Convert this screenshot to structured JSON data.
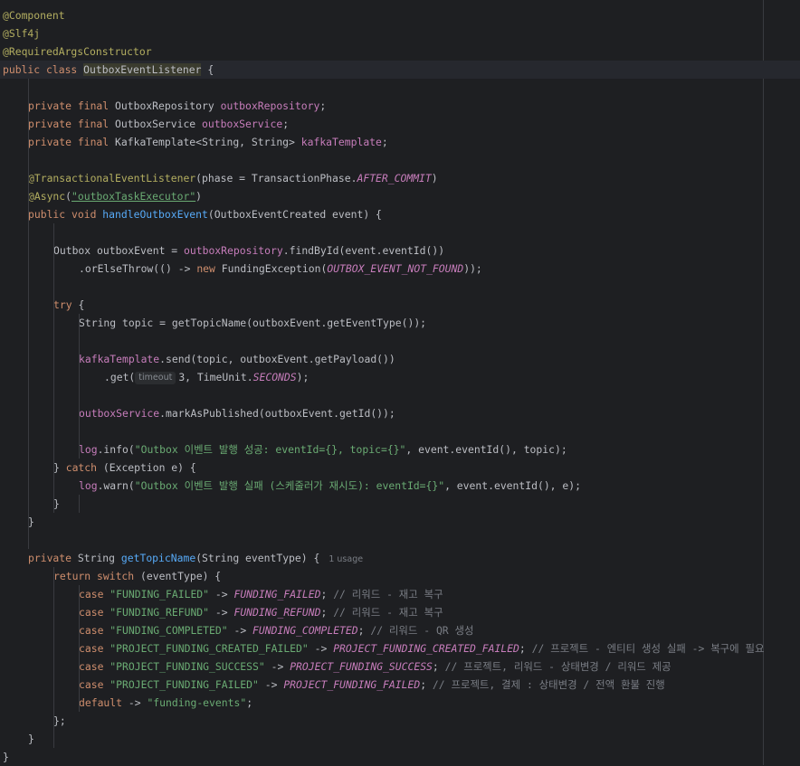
{
  "editor": {
    "file_class": "OutboxEventListener",
    "usage_hint": "1 usage",
    "param_hint": "timeout",
    "lines": [
      {
        "indent": 0,
        "tokens": [
          {
            "t": "@Component",
            "c": "a"
          }
        ]
      },
      {
        "indent": 0,
        "tokens": [
          {
            "t": "@Slf4j",
            "c": "a"
          }
        ]
      },
      {
        "indent": 0,
        "tokens": [
          {
            "t": "@RequiredArgsConstructor",
            "c": "a"
          }
        ]
      },
      {
        "indent": 0,
        "current": true,
        "tokens": [
          {
            "t": "public class ",
            "c": "k"
          },
          {
            "t": "OutboxEventListener",
            "c": "p hl"
          },
          {
            "t": " {",
            "c": "p"
          }
        ]
      },
      {
        "indent": 0,
        "tokens": []
      },
      {
        "indent": 1,
        "tokens": [
          {
            "t": "private final ",
            "c": "k"
          },
          {
            "t": "OutboxRepository ",
            "c": "p"
          },
          {
            "t": "outboxRepository",
            "c": "fld"
          },
          {
            "t": ";",
            "c": "p"
          }
        ]
      },
      {
        "indent": 1,
        "tokens": [
          {
            "t": "private final ",
            "c": "k"
          },
          {
            "t": "OutboxService ",
            "c": "p"
          },
          {
            "t": "outboxService",
            "c": "fld"
          },
          {
            "t": ";",
            "c": "p"
          }
        ]
      },
      {
        "indent": 1,
        "tokens": [
          {
            "t": "private final ",
            "c": "k"
          },
          {
            "t": "KafkaTemplate<String, String> ",
            "c": "p"
          },
          {
            "t": "kafkaTemplate",
            "c": "fld"
          },
          {
            "t": ";",
            "c": "p"
          }
        ]
      },
      {
        "indent": 0,
        "tokens": []
      },
      {
        "indent": 1,
        "tokens": [
          {
            "t": "@TransactionalEventListener",
            "c": "a"
          },
          {
            "t": "(phase = TransactionPhase.",
            "c": "p"
          },
          {
            "t": "AFTER_COMMIT",
            "c": "st"
          },
          {
            "t": ")",
            "c": "p"
          }
        ]
      },
      {
        "indent": 1,
        "tokens": [
          {
            "t": "@Async",
            "c": "a"
          },
          {
            "t": "(",
            "c": "p"
          },
          {
            "t": "\"outboxTaskExecutor\"",
            "c": "s ul"
          },
          {
            "t": ")",
            "c": "p"
          }
        ]
      },
      {
        "indent": 1,
        "tokens": [
          {
            "t": "public void ",
            "c": "k"
          },
          {
            "t": "handleOutboxEvent",
            "c": "f"
          },
          {
            "t": "(OutboxEventCreated event) {",
            "c": "p"
          }
        ]
      },
      {
        "indent": 0,
        "tokens": []
      },
      {
        "indent": 2,
        "tokens": [
          {
            "t": "Outbox outboxEvent = ",
            "c": "p"
          },
          {
            "t": "outboxRepository",
            "c": "fld"
          },
          {
            "t": ".findById(event.eventId())",
            "c": "p"
          }
        ]
      },
      {
        "indent": 3,
        "tokens": [
          {
            "t": ".orElseThrow(() -> ",
            "c": "p"
          },
          {
            "t": "new ",
            "c": "k"
          },
          {
            "t": "FundingException(",
            "c": "p"
          },
          {
            "t": "OUTBOX_EVENT_NOT_FOUND",
            "c": "st"
          },
          {
            "t": "));",
            "c": "p"
          }
        ]
      },
      {
        "indent": 0,
        "tokens": []
      },
      {
        "indent": 2,
        "tokens": [
          {
            "t": "try ",
            "c": "k"
          },
          {
            "t": "{",
            "c": "p"
          }
        ]
      },
      {
        "indent": 3,
        "tokens": [
          {
            "t": "String topic = getTopicName(outboxEvent.getEventType());",
            "c": "p"
          }
        ]
      },
      {
        "indent": 0,
        "tokens": []
      },
      {
        "indent": 3,
        "tokens": [
          {
            "t": "kafkaTemplate",
            "c": "fld"
          },
          {
            "t": ".send(topic, outboxEvent.getPayload())",
            "c": "p"
          }
        ]
      },
      {
        "indent": 4,
        "hint": true,
        "tokens": [
          {
            "t": ".get(",
            "c": "p"
          },
          {
            "t": "HINT",
            "c": "hint"
          },
          {
            "t": "3, TimeUnit.",
            "c": "p"
          },
          {
            "t": "SECONDS",
            "c": "st"
          },
          {
            "t": ");",
            "c": "p"
          }
        ]
      },
      {
        "indent": 0,
        "tokens": []
      },
      {
        "indent": 3,
        "tokens": [
          {
            "t": "outboxService",
            "c": "fld"
          },
          {
            "t": ".markAsPublished(outboxEvent.getId());",
            "c": "p"
          }
        ]
      },
      {
        "indent": 0,
        "tokens": []
      },
      {
        "indent": 3,
        "tokens": [
          {
            "t": "log",
            "c": "fld"
          },
          {
            "t": ".info(",
            "c": "p"
          },
          {
            "t": "\"Outbox 이벤트 발행 성공: eventId={}, topic={}\"",
            "c": "s"
          },
          {
            "t": ", event.eventId(), topic);",
            "c": "p"
          }
        ]
      },
      {
        "indent": 2,
        "tokens": [
          {
            "t": "} ",
            "c": "p"
          },
          {
            "t": "catch ",
            "c": "k"
          },
          {
            "t": "(Exception e) {",
            "c": "p"
          }
        ]
      },
      {
        "indent": 3,
        "tokens": [
          {
            "t": "log",
            "c": "fld"
          },
          {
            "t": ".warn(",
            "c": "p"
          },
          {
            "t": "\"Outbox 이벤트 발행 실패 (스케줄러가 재시도): eventId={}\"",
            "c": "s"
          },
          {
            "t": ", event.eventId(), e);",
            "c": "p"
          }
        ]
      },
      {
        "indent": 2,
        "tokens": [
          {
            "t": "}",
            "c": "p"
          }
        ]
      },
      {
        "indent": 1,
        "tokens": [
          {
            "t": "}",
            "c": "p"
          }
        ]
      },
      {
        "indent": 0,
        "tokens": []
      },
      {
        "indent": 1,
        "usage": true,
        "tokens": [
          {
            "t": "private ",
            "c": "k"
          },
          {
            "t": "String ",
            "c": "p"
          },
          {
            "t": "getTopicName",
            "c": "f"
          },
          {
            "t": "(String eventType) {",
            "c": "p"
          }
        ]
      },
      {
        "indent": 2,
        "tokens": [
          {
            "t": "return switch ",
            "c": "k"
          },
          {
            "t": "(eventType) {",
            "c": "p"
          }
        ]
      },
      {
        "indent": 3,
        "tokens": [
          {
            "t": "case ",
            "c": "k"
          },
          {
            "t": "\"FUNDING_FAILED\"",
            "c": "s"
          },
          {
            "t": " -> ",
            "c": "p"
          },
          {
            "t": "FUNDING_FAILED",
            "c": "st"
          },
          {
            "t": "; ",
            "c": "p"
          },
          {
            "t": "// 리워드 - 재고 복구",
            "c": "c"
          }
        ]
      },
      {
        "indent": 3,
        "tokens": [
          {
            "t": "case ",
            "c": "k"
          },
          {
            "t": "\"FUNDING_REFUND\"",
            "c": "s"
          },
          {
            "t": " -> ",
            "c": "p"
          },
          {
            "t": "FUNDING_REFUND",
            "c": "st"
          },
          {
            "t": "; ",
            "c": "p"
          },
          {
            "t": "// 리워드 - 재고 복구",
            "c": "c"
          }
        ]
      },
      {
        "indent": 3,
        "tokens": [
          {
            "t": "case ",
            "c": "k"
          },
          {
            "t": "\"FUNDING_COMPLETED\"",
            "c": "s"
          },
          {
            "t": " -> ",
            "c": "p"
          },
          {
            "t": "FUNDING_COMPLETED",
            "c": "st"
          },
          {
            "t": "; ",
            "c": "p"
          },
          {
            "t": "// 리워드 - QR 생성",
            "c": "c"
          }
        ]
      },
      {
        "indent": 3,
        "tokens": [
          {
            "t": "case ",
            "c": "k"
          },
          {
            "t": "\"PROJECT_FUNDING_CREATED_FAILED\"",
            "c": "s"
          },
          {
            "t": " -> ",
            "c": "p"
          },
          {
            "t": "PROJECT_FUNDING_CREATED_FAILED",
            "c": "st"
          },
          {
            "t": "; ",
            "c": "p"
          },
          {
            "t": "// 프로젝트 - 엔티티 생성 실패 -> 복구에 필요",
            "c": "c"
          }
        ]
      },
      {
        "indent": 3,
        "tokens": [
          {
            "t": "case ",
            "c": "k"
          },
          {
            "t": "\"PROJECT_FUNDING_SUCCESS\"",
            "c": "s"
          },
          {
            "t": " -> ",
            "c": "p"
          },
          {
            "t": "PROJECT_FUNDING_SUCCESS",
            "c": "st"
          },
          {
            "t": "; ",
            "c": "p"
          },
          {
            "t": "// 프로젝트, 리워드 - 상태변경 / 리워드 제공",
            "c": "c"
          }
        ]
      },
      {
        "indent": 3,
        "tokens": [
          {
            "t": "case ",
            "c": "k"
          },
          {
            "t": "\"PROJECT_FUNDING_FAILED\"",
            "c": "s"
          },
          {
            "t": " -> ",
            "c": "p"
          },
          {
            "t": "PROJECT_FUNDING_FAILED",
            "c": "st"
          },
          {
            "t": "; ",
            "c": "p"
          },
          {
            "t": "// 프로젝트, 결제 : 상태변경 / 전액 환불 진행",
            "c": "c"
          }
        ]
      },
      {
        "indent": 3,
        "tokens": [
          {
            "t": "default ",
            "c": "k"
          },
          {
            "t": "-> ",
            "c": "p"
          },
          {
            "t": "\"funding-events\"",
            "c": "s"
          },
          {
            "t": ";",
            "c": "p"
          }
        ]
      },
      {
        "indent": 2,
        "tokens": [
          {
            "t": "};",
            "c": "p"
          }
        ]
      },
      {
        "indent": 1,
        "tokens": [
          {
            "t": "}",
            "c": "p"
          }
        ]
      },
      {
        "indent": 0,
        "tokens": [
          {
            "t": "}",
            "c": "p"
          }
        ]
      }
    ]
  }
}
